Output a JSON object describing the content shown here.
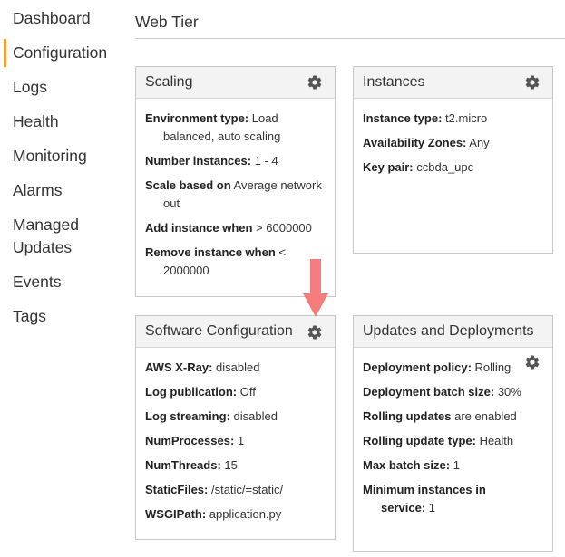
{
  "sidebar": {
    "items": [
      {
        "label": "Dashboard"
      },
      {
        "label": "Configuration",
        "active": true
      },
      {
        "label": "Logs"
      },
      {
        "label": "Health"
      },
      {
        "label": "Monitoring"
      },
      {
        "label": "Alarms"
      },
      {
        "label": "Managed Updates"
      },
      {
        "label": "Events"
      },
      {
        "label": "Tags"
      }
    ]
  },
  "section": {
    "title": "Web Tier"
  },
  "panels": {
    "scaling": {
      "title": "Scaling",
      "rows": [
        {
          "key": "Environment type:",
          "value": " Load balanced, auto scaling"
        },
        {
          "key": "Number instances:",
          "value": " 1 - 4"
        },
        {
          "key": "Scale based on",
          "value": " Average network out"
        },
        {
          "key": "Add instance when",
          "value": " > 6000000"
        },
        {
          "key": "Remove instance when",
          "value": " < 2000000"
        }
      ]
    },
    "instances": {
      "title": "Instances",
      "rows": [
        {
          "key": "Instance type:",
          "value": " t2.micro"
        },
        {
          "key": "Availability Zones:",
          "value": " Any"
        },
        {
          "key": "Key pair:",
          "value": " ccbda_upc"
        }
      ]
    },
    "software": {
      "title": "Software Configuration",
      "rows": [
        {
          "key": "AWS X-Ray:",
          "value": " disabled"
        },
        {
          "key": "Log publication:",
          "value": " Off"
        },
        {
          "key": "Log streaming:",
          "value": " disabled"
        },
        {
          "key": "NumProcesses:",
          "value": " 1"
        },
        {
          "key": "NumThreads:",
          "value": " 15"
        },
        {
          "key": "StaticFiles:",
          "value": " /static/=static/"
        },
        {
          "key": "WSGIPath:",
          "value": " application.py"
        }
      ]
    },
    "updates": {
      "title": "Updates and Deployments",
      "rows": [
        {
          "key": "Deployment policy:",
          "value": " Rolling"
        },
        {
          "key": "Deployment batch size:",
          "value": " 30%"
        },
        {
          "key": "Rolling updates",
          "value": " are enabled"
        },
        {
          "key": "Rolling update type:",
          "value": " Health"
        },
        {
          "key": "Max batch size:",
          "value": " 1"
        },
        {
          "key": "Minimum instances in service:",
          "value": " 1"
        }
      ]
    }
  },
  "icons": {
    "gear": "gear-icon",
    "arrow": "down-arrow-icon"
  },
  "colors": {
    "active_indicator": "#f7a23b",
    "arrow": "#f47c7c",
    "gear": "#555555"
  }
}
